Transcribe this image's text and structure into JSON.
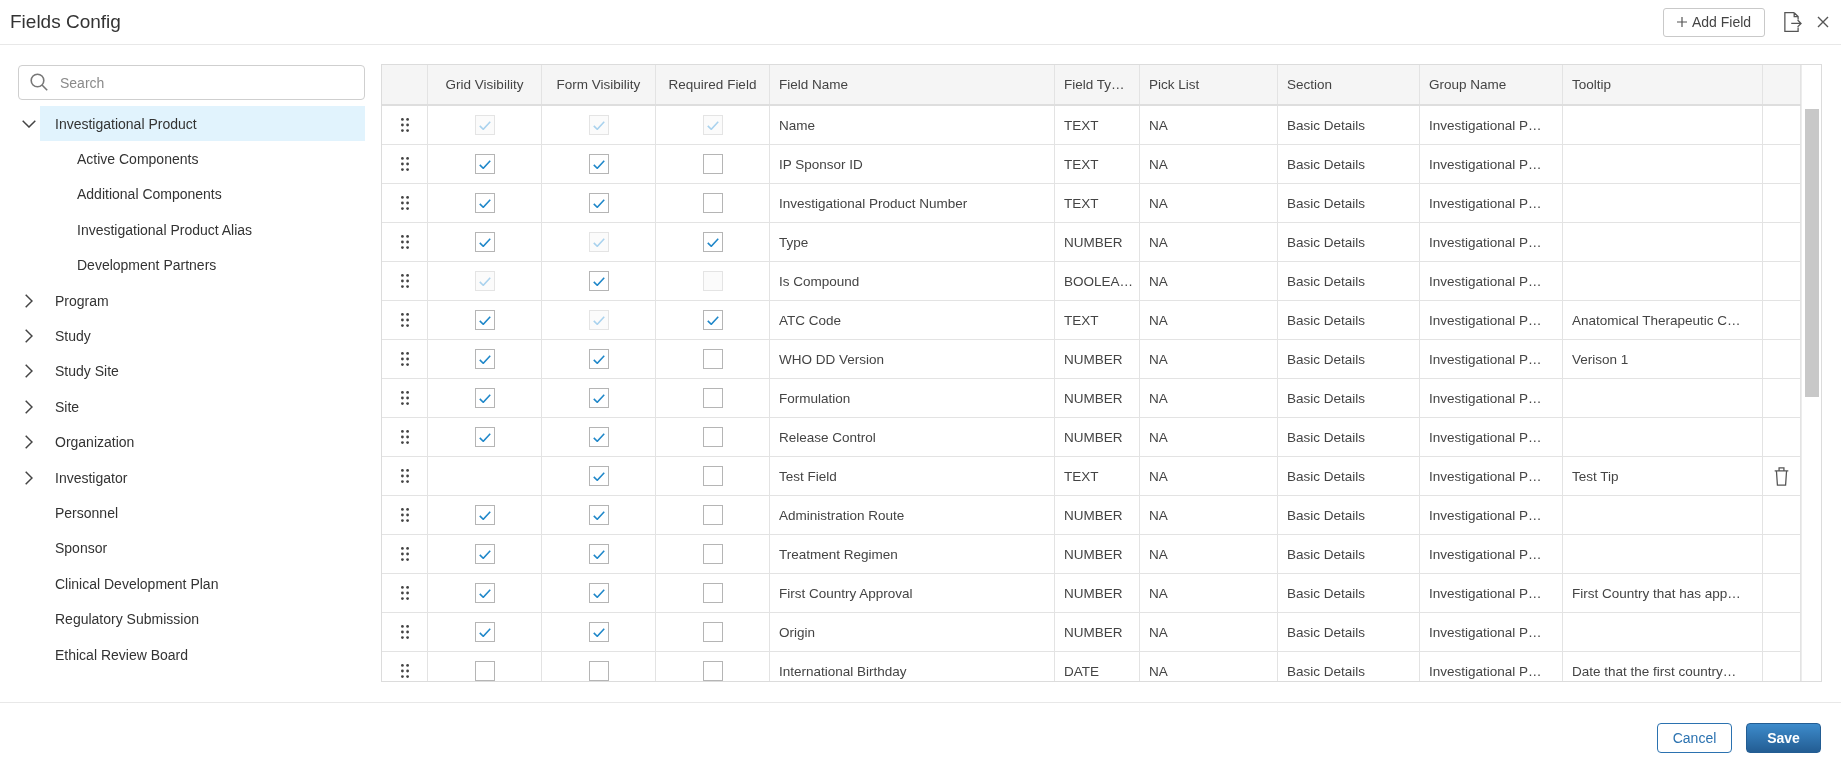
{
  "dialog": {
    "title": "Fields Config",
    "add_button": "Add Field"
  },
  "sidebar": {
    "search": {
      "placeholder": "Search"
    },
    "tree": [
      {
        "label": "Investigational Product",
        "expandable": true,
        "expanded": true,
        "selected": true,
        "children": [
          {
            "label": "Active Components",
            "selected": false
          },
          {
            "label": "Additional Components",
            "selected": false
          },
          {
            "label": "Investigational Product Alias",
            "selected": false
          },
          {
            "label": "Development Partners",
            "selected": false
          }
        ]
      },
      {
        "label": "Program",
        "expandable": true,
        "expanded": false,
        "selected": false
      },
      {
        "label": "Study",
        "expandable": true,
        "expanded": false,
        "selected": false
      },
      {
        "label": "Study Site",
        "expandable": true,
        "expanded": false,
        "selected": false
      },
      {
        "label": "Site",
        "expandable": true,
        "expanded": false,
        "selected": false
      },
      {
        "label": "Organization",
        "expandable": true,
        "expanded": false,
        "selected": false
      },
      {
        "label": "Investigator",
        "expandable": true,
        "expanded": false,
        "selected": false
      },
      {
        "label": "Personnel",
        "expandable": false,
        "selected": false
      },
      {
        "label": "Sponsor",
        "expandable": false,
        "selected": false
      },
      {
        "label": "Clinical Development Plan",
        "expandable": false,
        "selected": false
      },
      {
        "label": "Regulatory Submission",
        "expandable": false,
        "selected": false
      },
      {
        "label": "Ethical Review Board",
        "expandable": false,
        "selected": false
      }
    ]
  },
  "table": {
    "columns": [
      {
        "label": "Grid Visibility",
        "kind": "checkbox"
      },
      {
        "label": "Form Visibility",
        "kind": "checkbox"
      },
      {
        "label": "Required Field",
        "kind": "checkbox"
      },
      {
        "label": "Field Name",
        "kind": "text"
      },
      {
        "label": "Field Ty…",
        "kind": "text"
      },
      {
        "label": "Pick List",
        "kind": "text"
      },
      {
        "label": "Section",
        "kind": "text"
      },
      {
        "label": "Group Name",
        "kind": "text"
      },
      {
        "label": "Tooltip",
        "kind": "text"
      }
    ],
    "rows": [
      {
        "grid_visibility": {
          "checked": true,
          "disabled": true
        },
        "form_visibility": {
          "checked": true,
          "disabled": true
        },
        "required_field": {
          "checked": true,
          "disabled": true
        },
        "field_name": "Name",
        "field_type": "TEXT",
        "pick_list": "NA",
        "section": "Basic Details",
        "group_name": "Investigational P…",
        "deletable": false
      },
      {
        "grid_visibility": {
          "checked": true,
          "disabled": false
        },
        "form_visibility": {
          "checked": true,
          "disabled": false
        },
        "required_field": {
          "checked": false,
          "disabled": false
        },
        "field_name": "IP Sponsor ID",
        "field_type": "TEXT",
        "pick_list": "NA",
        "section": "Basic Details",
        "group_name": "Investigational P…",
        "deletable": false
      },
      {
        "grid_visibility": {
          "checked": true,
          "disabled": false
        },
        "form_visibility": {
          "checked": true,
          "disabled": false
        },
        "required_field": {
          "checked": false,
          "disabled": false
        },
        "field_name": "Investigational Product Number",
        "field_type": "TEXT",
        "pick_list": "NA",
        "section": "Basic Details",
        "group_name": "Investigational P…",
        "deletable": false
      },
      {
        "grid_visibility": {
          "checked": true,
          "disabled": false
        },
        "form_visibility": {
          "checked": true,
          "disabled": true
        },
        "required_field": {
          "checked": true,
          "disabled": false
        },
        "field_name": "Type",
        "field_type": "NUMBER",
        "pick_list": "NA",
        "section": "Basic Details",
        "group_name": "Investigational P…",
        "deletable": false
      },
      {
        "grid_visibility": {
          "checked": true,
          "disabled": true
        },
        "form_visibility": {
          "checked": true,
          "disabled": false
        },
        "required_field": {
          "checked": false,
          "disabled": true
        },
        "field_name": "Is Compound",
        "field_type": "BOOLEA…",
        "pick_list": "NA",
        "section": "Basic Details",
        "group_name": "Investigational P…",
        "deletable": false
      },
      {
        "grid_visibility": {
          "checked": true,
          "disabled": false
        },
        "form_visibility": {
          "checked": true,
          "disabled": true
        },
        "required_field": {
          "checked": true,
          "disabled": false
        },
        "field_name": "ATC Code",
        "field_type": "TEXT",
        "pick_list": "NA",
        "section": "Basic Details",
        "group_name": "Investigational P…",
        "tooltip": "Anatomical Therapeutic C…",
        "deletable": false
      },
      {
        "grid_visibility": {
          "checked": true,
          "disabled": false
        },
        "form_visibility": {
          "checked": true,
          "disabled": false
        },
        "required_field": {
          "checked": false,
          "disabled": false
        },
        "field_name": "WHO DD Version",
        "field_type": "NUMBER",
        "pick_list": "NA",
        "section": "Basic Details",
        "group_name": "Investigational P…",
        "tooltip": "Verison 1",
        "deletable": false
      },
      {
        "grid_visibility": {
          "checked": true,
          "disabled": false
        },
        "form_visibility": {
          "checked": true,
          "disabled": false
        },
        "required_field": {
          "checked": false,
          "disabled": false
        },
        "field_name": "Formulation",
        "field_type": "NUMBER",
        "pick_list": "NA",
        "section": "Basic Details",
        "group_name": "Investigational P…",
        "deletable": false
      },
      {
        "grid_visibility": {
          "checked": true,
          "disabled": false
        },
        "form_visibility": {
          "checked": true,
          "disabled": false
        },
        "required_field": {
          "checked": false,
          "disabled": false
        },
        "field_name": "Release Control",
        "field_type": "NUMBER",
        "pick_list": "NA",
        "section": "Basic Details",
        "group_name": "Investigational P…",
        "deletable": false
      },
      {
        "form_visibility": {
          "checked": true,
          "disabled": false
        },
        "required_field": {
          "checked": false,
          "disabled": false
        },
        "field_name": "Test Field",
        "field_type": "TEXT",
        "pick_list": "NA",
        "section": "Basic Details",
        "group_name": "Investigational P…",
        "tooltip": "Test Tip",
        "deletable": true
      },
      {
        "grid_visibility": {
          "checked": true,
          "disabled": false
        },
        "form_visibility": {
          "checked": true,
          "disabled": false
        },
        "required_field": {
          "checked": false,
          "disabled": false
        },
        "field_name": "Administration Route",
        "field_type": "NUMBER",
        "pick_list": "NA",
        "section": "Basic Details",
        "group_name": "Investigational P…",
        "deletable": false
      },
      {
        "grid_visibility": {
          "checked": true,
          "disabled": false
        },
        "form_visibility": {
          "checked": true,
          "disabled": false
        },
        "required_field": {
          "checked": false,
          "disabled": false
        },
        "field_name": "Treatment Regimen",
        "field_type": "NUMBER",
        "pick_list": "NA",
        "section": "Basic Details",
        "group_name": "Investigational P…",
        "deletable": false
      },
      {
        "grid_visibility": {
          "checked": true,
          "disabled": false
        },
        "form_visibility": {
          "checked": true,
          "disabled": false
        },
        "required_field": {
          "checked": false,
          "disabled": false
        },
        "field_name": "First Country Approval",
        "field_type": "NUMBER",
        "pick_list": "NA",
        "section": "Basic Details",
        "group_name": "Investigational P…",
        "tooltip": "First Country that has app…",
        "deletable": false
      },
      {
        "grid_visibility": {
          "checked": true,
          "disabled": false
        },
        "form_visibility": {
          "checked": true,
          "disabled": false
        },
        "required_field": {
          "checked": false,
          "disabled": false
        },
        "field_name": "Origin",
        "field_type": "NUMBER",
        "pick_list": "NA",
        "section": "Basic Details",
        "group_name": "Investigational P…",
        "deletable": false
      },
      {
        "grid_visibility": {
          "checked": false,
          "disabled": false
        },
        "form_visibility": {
          "checked": false,
          "disabled": false
        },
        "required_field": {
          "checked": false,
          "disabled": false
        },
        "field_name": "International Birthday",
        "field_type": "DATE",
        "pick_list": "NA",
        "section": "Basic Details",
        "group_name": "Investigational P…",
        "tooltip": "Date that the first country…",
        "deletable": false
      }
    ]
  },
  "footer": {
    "buttons": [
      {
        "label": "Cancel",
        "kind": "secondary"
      },
      {
        "label": "Save",
        "kind": "primary"
      }
    ]
  }
}
